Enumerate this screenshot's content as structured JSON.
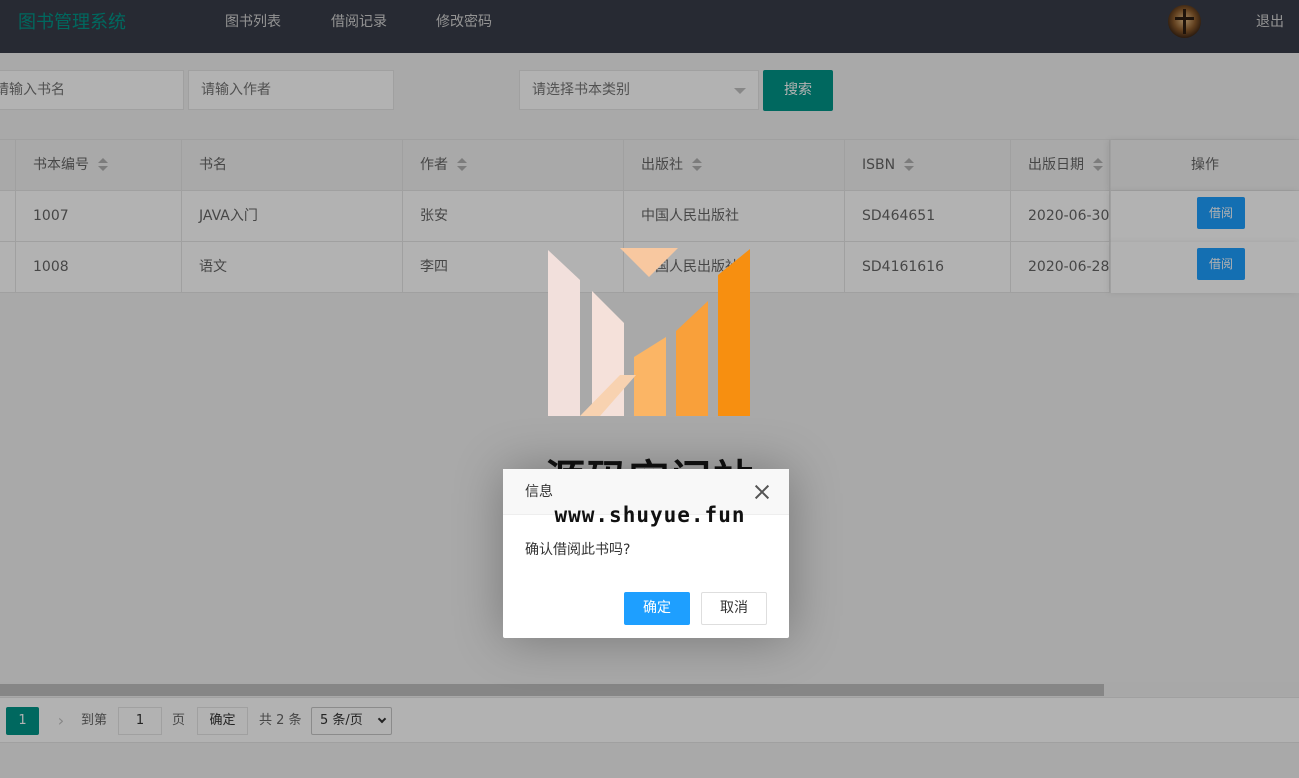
{
  "header": {
    "brand": "图书管理系统",
    "nav": [
      "图书列表",
      "借阅记录",
      "修改密码"
    ],
    "logout": "退出"
  },
  "search": {
    "book_name_placeholder": "请输入书名",
    "author_placeholder": "请输入作者",
    "category_placeholder": "请选择书本类别",
    "search_button": "搜索"
  },
  "table": {
    "columns": [
      "书本编号",
      "书名",
      "作者",
      "出版社",
      "ISBN",
      "出版日期",
      "操作"
    ],
    "rows": [
      {
        "id": "1007",
        "name": "JAVA入门",
        "author": "张安",
        "publisher": "中国人民出版社",
        "isbn": "SD464651",
        "date": "2020-06-30",
        "action": "借阅"
      },
      {
        "id": "1008",
        "name": "语文",
        "author": "李四",
        "publisher": "中国人民出版社",
        "isbn": "SD4161616",
        "date": "2020-06-28",
        "action": "借阅"
      }
    ]
  },
  "pagination": {
    "current_page": "1",
    "goto_prefix": "到第",
    "goto_value": "1",
    "goto_suffix": "页",
    "confirm": "确定",
    "total": "共 2 条",
    "page_size": "5 条/页"
  },
  "dialog": {
    "title": "信息",
    "message": "确认借阅此书吗?",
    "ok": "确定",
    "cancel": "取消"
  },
  "watermark": {
    "title": "源码空间站",
    "url": "www.shuyue.fun"
  },
  "colors": {
    "header_bg": "#393d49",
    "primary_teal": "#009688",
    "primary_blue": "#1e9fff"
  }
}
